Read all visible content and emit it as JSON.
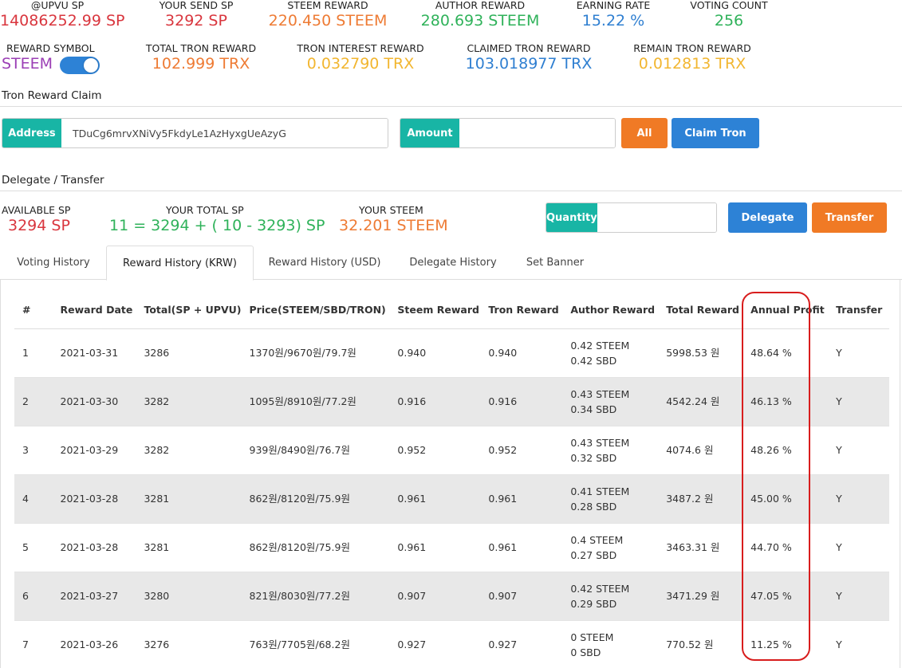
{
  "stats_row1": [
    {
      "label": "@UPVU SP",
      "value": "14086252.99 SP",
      "color": "red"
    },
    {
      "label": "YOUR SEND SP",
      "value": "3292 SP",
      "color": "red"
    },
    {
      "label": "STEEM REWARD",
      "value": "220.450 STEEM",
      "color": "orange"
    },
    {
      "label": "AUTHOR REWARD",
      "value": "280.693 STEEM",
      "color": "green"
    },
    {
      "label": "EARNING RATE",
      "value": "15.22 %",
      "color": "blue"
    },
    {
      "label": "VOTING COUNT",
      "value": "256",
      "color": "green"
    }
  ],
  "stats_row2": [
    {
      "label": "REWARD SYMBOL",
      "value": "STEEM",
      "color": "purple"
    },
    {
      "label": "TOTAL TRON REWARD",
      "value": "102.999 TRX",
      "color": "orange"
    },
    {
      "label": "TRON INTEREST REWARD",
      "value": "0.032790 TRX",
      "color": "yellow"
    },
    {
      "label": "CLAIMED TRON REWARD",
      "value": "103.018977 TRX",
      "color": "blue"
    },
    {
      "label": "REMAIN TRON REWARD",
      "value": "0.012813 TRX",
      "color": "yellow"
    }
  ],
  "tron_claim": {
    "title": "Tron Reward Claim",
    "address_label": "Address",
    "address_value": "TDuCg6mrvXNiVy5FkdyLe1AzHyxgUeAzyG",
    "amount_label": "Amount",
    "amount_value": "",
    "all_button": "All",
    "claim_button": "Claim Tron"
  },
  "delegate": {
    "title": "Delegate / Transfer",
    "available_label": "AVAILABLE SP",
    "available_value": "3294 SP",
    "total_label": "YOUR TOTAL SP",
    "total_value": "11 = 3294 + ( 10 - 3293) SP",
    "steem_label": "YOUR STEEM",
    "steem_value": "32.201 STEEM",
    "quantity_label": "Quantity",
    "quantity_value": "",
    "delegate_button": "Delegate",
    "transfer_button": "Transfer"
  },
  "tabs": [
    "Voting History",
    "Reward History (KRW)",
    "Reward History (USD)",
    "Delegate History",
    "Set Banner"
  ],
  "active_tab": 1,
  "table": {
    "headers": [
      "#",
      "Reward Date",
      "Total(SP + UPVU)",
      "Price(STEEM/SBD/TRON)",
      "Steem Reward",
      "Tron Reward",
      "Author Reward",
      "Total Reward",
      "Annual Profit",
      "Transfer"
    ],
    "rows": [
      {
        "n": "1",
        "date": "2021-03-31",
        "total": "3286",
        "price": "1370원/9670원/79.7원",
        "steem": "0.940",
        "tron": "0.940",
        "author1": "0.42 STEEM",
        "author2": "0.42 SBD",
        "total_reward": "5998.53 원",
        "annual": "48.64 %",
        "transfer": "Y"
      },
      {
        "n": "2",
        "date": "2021-03-30",
        "total": "3282",
        "price": "1095원/8910원/77.2원",
        "steem": "0.916",
        "tron": "0.916",
        "author1": "0.43 STEEM",
        "author2": "0.34 SBD",
        "total_reward": "4542.24 원",
        "annual": "46.13 %",
        "transfer": "Y"
      },
      {
        "n": "3",
        "date": "2021-03-29",
        "total": "3282",
        "price": "939원/8490원/76.7원",
        "steem": "0.952",
        "tron": "0.952",
        "author1": "0.43 STEEM",
        "author2": "0.32 SBD",
        "total_reward": "4074.6 원",
        "annual": "48.26 %",
        "transfer": "Y"
      },
      {
        "n": "4",
        "date": "2021-03-28",
        "total": "3281",
        "price": "862원/8120원/75.9원",
        "steem": "0.961",
        "tron": "0.961",
        "author1": "0.41 STEEM",
        "author2": "0.28 SBD",
        "total_reward": "3487.2 원",
        "annual": "45.00 %",
        "transfer": "Y"
      },
      {
        "n": "5",
        "date": "2021-03-28",
        "total": "3281",
        "price": "862원/8120원/75.9원",
        "steem": "0.961",
        "tron": "0.961",
        "author1": "0.4 STEEM",
        "author2": "0.27 SBD",
        "total_reward": "3463.31 원",
        "annual": "44.70 %",
        "transfer": "Y"
      },
      {
        "n": "6",
        "date": "2021-03-27",
        "total": "3280",
        "price": "821원/8030원/77.2원",
        "steem": "0.907",
        "tron": "0.907",
        "author1": "0.42 STEEM",
        "author2": "0.29 SBD",
        "total_reward": "3471.29 원",
        "annual": "47.05 %",
        "transfer": "Y"
      },
      {
        "n": "7",
        "date": "2021-03-26",
        "total": "3276",
        "price": "763원/7705원/68.2원",
        "steem": "0.927",
        "tron": "0.927",
        "author1": "0 STEEM",
        "author2": "0 SBD",
        "total_reward": "770.52 원",
        "annual": "11.25 %",
        "transfer": "Y"
      }
    ]
  }
}
